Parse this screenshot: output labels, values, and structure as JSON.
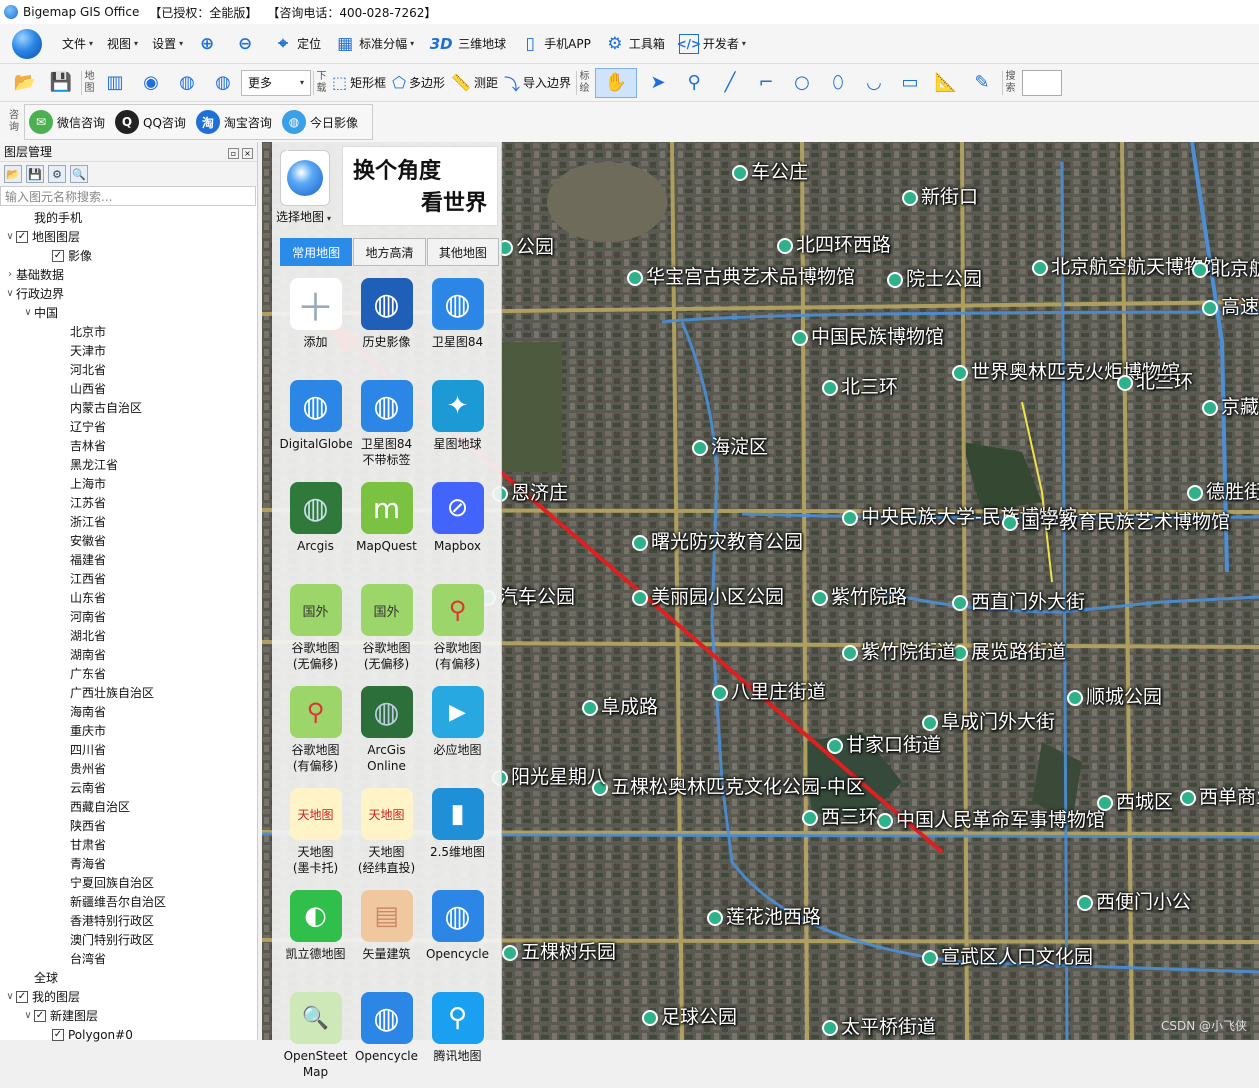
{
  "titlebar": {
    "app": "Bigemap GIS Office",
    "license": "【已授权：全能版】",
    "contact": "【咨询电话：400-028-7262】"
  },
  "menu": [
    {
      "label": "文件",
      "icon": "file-icon"
    },
    {
      "label": "视图",
      "icon": "view-icon"
    },
    {
      "label": "设置",
      "icon": "settings-icon"
    },
    {
      "label": "",
      "icon": "zoom-in-icon"
    },
    {
      "label": "",
      "icon": "zoom-out-icon"
    },
    {
      "label": "定位",
      "icon": "location-icon"
    },
    {
      "label": "标准分幅",
      "icon": "grid-icon"
    },
    {
      "label": "三维地球",
      "icon": "3d-icon"
    },
    {
      "label": "手机APP",
      "icon": "phone-icon"
    },
    {
      "label": "工具箱",
      "icon": "gear-icon"
    },
    {
      "label": "开发者",
      "icon": "code-icon"
    }
  ],
  "toolbar": {
    "map_section": "地图",
    "more": "更多",
    "download_section": "下载",
    "rect": "矩形框",
    "polygon": "多边形",
    "measure": "测距",
    "import_boundary": "导入边界",
    "draw_section": "标绘",
    "search_section": "搜索"
  },
  "consult": {
    "section": "咨询",
    "items": [
      {
        "label": "微信咨询",
        "color": "#4caf50"
      },
      {
        "label": "QQ咨询",
        "color": "#222222"
      },
      {
        "label": "淘宝咨询",
        "color": "#1e6fd8"
      },
      {
        "label": "今日影像",
        "color": "#3aa0e8"
      }
    ]
  },
  "layers": {
    "title": "图层管理",
    "search_placeholder": "输入图元名称搜索...",
    "nodes": [
      {
        "label": "我的手机",
        "level": 1,
        "toggle": "",
        "check": ""
      },
      {
        "label": "地图图层",
        "level": 0,
        "toggle": "∨",
        "check": "✓"
      },
      {
        "label": "影像",
        "level": 2,
        "toggle": "",
        "check": "✓"
      },
      {
        "label": "基础数据",
        "level": 0,
        "toggle": "›",
        "check": ""
      },
      {
        "label": "行政边界",
        "level": 0,
        "toggle": "∨",
        "check": ""
      },
      {
        "label": "中国",
        "level": 1,
        "toggle": "∨",
        "check": ""
      },
      {
        "label": "北京市",
        "level": 3,
        "toggle": "",
        "check": ""
      },
      {
        "label": "天津市",
        "level": 3,
        "toggle": "",
        "check": ""
      },
      {
        "label": "河北省",
        "level": 3,
        "toggle": "",
        "check": ""
      },
      {
        "label": "山西省",
        "level": 3,
        "toggle": "",
        "check": ""
      },
      {
        "label": "内蒙古自治区",
        "level": 3,
        "toggle": "",
        "check": ""
      },
      {
        "label": "辽宁省",
        "level": 3,
        "toggle": "",
        "check": ""
      },
      {
        "label": "吉林省",
        "level": 3,
        "toggle": "",
        "check": ""
      },
      {
        "label": "黑龙江省",
        "level": 3,
        "toggle": "",
        "check": ""
      },
      {
        "label": "上海市",
        "level": 3,
        "toggle": "",
        "check": ""
      },
      {
        "label": "江苏省",
        "level": 3,
        "toggle": "",
        "check": ""
      },
      {
        "label": "浙江省",
        "level": 3,
        "toggle": "",
        "check": ""
      },
      {
        "label": "安徽省",
        "level": 3,
        "toggle": "",
        "check": ""
      },
      {
        "label": "福建省",
        "level": 3,
        "toggle": "",
        "check": ""
      },
      {
        "label": "江西省",
        "level": 3,
        "toggle": "",
        "check": ""
      },
      {
        "label": "山东省",
        "level": 3,
        "toggle": "",
        "check": ""
      },
      {
        "label": "河南省",
        "level": 3,
        "toggle": "",
        "check": ""
      },
      {
        "label": "湖北省",
        "level": 3,
        "toggle": "",
        "check": ""
      },
      {
        "label": "湖南省",
        "level": 3,
        "toggle": "",
        "check": ""
      },
      {
        "label": "广东省",
        "level": 3,
        "toggle": "",
        "check": ""
      },
      {
        "label": "广西壮族自治区",
        "level": 3,
        "toggle": "",
        "check": ""
      },
      {
        "label": "海南省",
        "level": 3,
        "toggle": "",
        "check": ""
      },
      {
        "label": "重庆市",
        "level": 3,
        "toggle": "",
        "check": ""
      },
      {
        "label": "四川省",
        "level": 3,
        "toggle": "",
        "check": ""
      },
      {
        "label": "贵州省",
        "level": 3,
        "toggle": "",
        "check": ""
      },
      {
        "label": "云南省",
        "level": 3,
        "toggle": "",
        "check": ""
      },
      {
        "label": "西藏自治区",
        "level": 3,
        "toggle": "",
        "check": ""
      },
      {
        "label": "陕西省",
        "level": 3,
        "toggle": "",
        "check": ""
      },
      {
        "label": "甘肃省",
        "level": 3,
        "toggle": "",
        "check": ""
      },
      {
        "label": "青海省",
        "level": 3,
        "toggle": "",
        "check": ""
      },
      {
        "label": "宁夏回族自治区",
        "level": 3,
        "toggle": "",
        "check": ""
      },
      {
        "label": "新疆维吾尔自治区",
        "level": 3,
        "toggle": "",
        "check": ""
      },
      {
        "label": "香港特别行政区",
        "level": 3,
        "toggle": "",
        "check": ""
      },
      {
        "label": "澳门特别行政区",
        "level": 3,
        "toggle": "",
        "check": ""
      },
      {
        "label": "台湾省",
        "level": 3,
        "toggle": "",
        "check": ""
      },
      {
        "label": "全球",
        "level": 1,
        "toggle": "",
        "check": ""
      },
      {
        "label": "我的图层",
        "level": 0,
        "toggle": "∨",
        "check": "✓"
      },
      {
        "label": "新建图层",
        "level": 1,
        "toggle": "∨",
        "check": "✓"
      },
      {
        "label": "Polygon#0",
        "level": 2,
        "toggle": "",
        "check": "✓"
      }
    ]
  },
  "picker": {
    "select_label": "选择地图",
    "slogan_line1": "换个角度",
    "slogan_line2": "看世界",
    "tabs": [
      "常用地图",
      "地方高清",
      "其他地图"
    ],
    "active_tab": 0,
    "items": [
      {
        "name": "添加",
        "icon": "add-icon"
      },
      {
        "name": "历史影像",
        "icon": "history-globe-icon"
      },
      {
        "name": "卫星图84",
        "icon": "globe-icon"
      },
      {
        "name": "DigitalGlobe",
        "icon": "globe-icon"
      },
      {
        "name": "卫星图84\n不带标签",
        "icon": "globe-icon"
      },
      {
        "name": "星图地球",
        "icon": "star-globe-icon"
      },
      {
        "name": "Arcgis",
        "icon": "arcgis-globe-icon"
      },
      {
        "name": "MapQuest",
        "icon": "mapquest-icon"
      },
      {
        "name": "Mapbox",
        "icon": "mapbox-icon"
      },
      {
        "name": "谷歌地图\n(无偏移)",
        "icon": "google-maps-foreign-icon"
      },
      {
        "name": "谷歌地图\n(无偏移)",
        "icon": "google-maps-foreign-icon"
      },
      {
        "name": "谷歌地图\n(有偏移)",
        "icon": "google-maps-icon"
      },
      {
        "name": "谷歌地图\n(有偏移)",
        "icon": "google-maps-pin-icon"
      },
      {
        "name": "ArcGis\nOnline",
        "icon": "arcgis-online-icon"
      },
      {
        "name": "必应地图",
        "icon": "bing-maps-icon"
      },
      {
        "name": "天地图\n(墨卡托)",
        "icon": "tianditu-icon"
      },
      {
        "name": "天地图\n(经纬直投)",
        "icon": "tianditu-icon"
      },
      {
        "name": "2.5维地图",
        "icon": "map-25d-icon"
      },
      {
        "name": "凯立德地图",
        "icon": "careland-icon"
      },
      {
        "name": "矢量建筑",
        "icon": "vector-building-icon"
      },
      {
        "name": "Opencycle",
        "icon": "globe-icon"
      },
      {
        "name": "OpenSteet\nMap",
        "icon": "osm-icon"
      },
      {
        "name": "Opencycle",
        "icon": "globe-icon"
      },
      {
        "name": "腾讯地图",
        "icon": "tencent-map-icon"
      }
    ]
  },
  "map": {
    "labels": [
      "北四环西路",
      "院士公园",
      "北京航空航天博物馆",
      "华宝宫古典艺术品博物馆",
      "中国民族博物馆",
      "世界奥林匹克火炬博物馆",
      "北三环",
      "海淀区",
      "中央民族大学-民族博物馆",
      "国学教育民族艺术博物馆",
      "曙光防灾教育公园",
      "美丽园小区公园",
      "紫竹院路",
      "西直门外大街",
      "展览路街道",
      "阜成路",
      "八里庄街道",
      "阜成门外大街",
      "甘家口街道",
      "顺城公园",
      "五棵松奥林匹克文化公园-中区",
      "中国人民革命军事博物馆",
      "西城区",
      "西单商业化博物馆",
      "莲花池西路",
      "西便门小公",
      "五棵树乐园",
      "宣武区人口文化园",
      "足球公园",
      "太平桥街道",
      "德胜街道",
      "恩济庄",
      "阳光星期八",
      "汽车公园",
      "北京航空",
      "紫竹院街道",
      "西三环",
      "高速",
      "京藏高速",
      "公园",
      "北三环",
      "新街口",
      "车公庄"
    ],
    "watermark": "CSDN @小飞侠"
  }
}
